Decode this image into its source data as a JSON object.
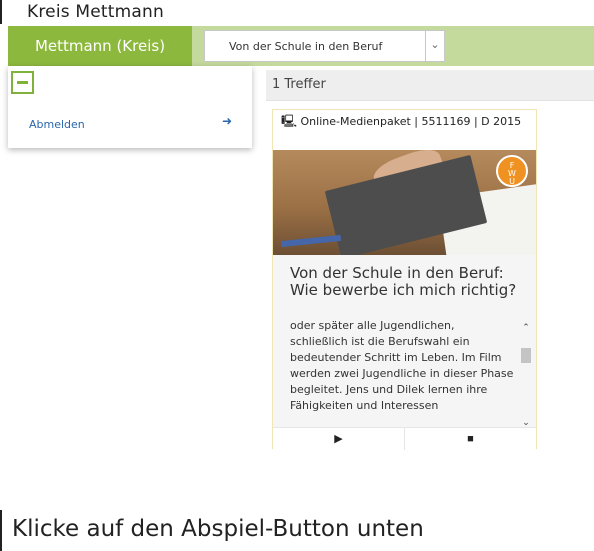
{
  "site": {
    "title": "Kreis Mettmann"
  },
  "nav": {
    "brand": "Mettmann (Kreis)",
    "filter_value": "Von der Schule in den Beruf"
  },
  "results": {
    "count_label": "1 Treffer"
  },
  "menu": {
    "logout_label": "Abmelden"
  },
  "card": {
    "meta": "Online-Medienpaket | 5511169 | D 2015",
    "badge": "FWU",
    "title": "Von der Schule in den Beruf: Wie bewerbe ich mich richtig?",
    "description": "oder später alle Jugendlichen, schließlich ist die Berufswahl ein bedeutender Schritt im Leben. Im Film werden zwei Jugendliche in dieser Phase begleitet. Jens und Dilek lernen ihre Fähigkeiten und Interessen"
  },
  "caption": {
    "text": "Klicke auf den Abspiel-Button unten"
  },
  "colors": {
    "brand": "#8cb83e",
    "nav_bg": "#c4d99c",
    "link": "#2a66ad",
    "badge": "#f09222"
  },
  "icons": [
    "monitor-icon",
    "logout-icon",
    "play-icon",
    "document-icon",
    "minus-icon",
    "chevron-down-icon"
  ]
}
